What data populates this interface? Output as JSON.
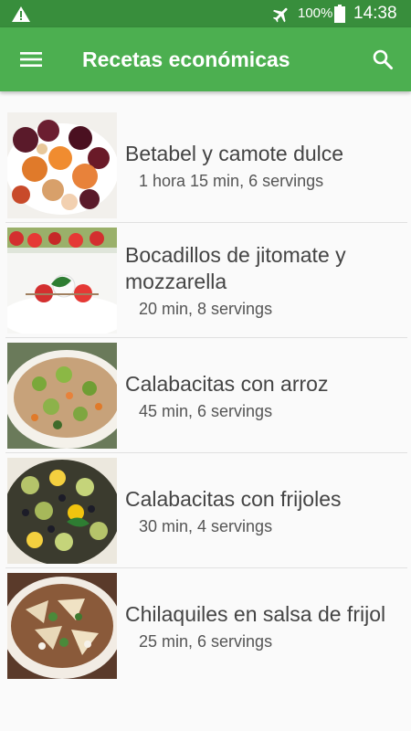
{
  "status_bar": {
    "battery": "100%",
    "time": "14:38",
    "icons": [
      "warning-icon",
      "airplane-mode-icon",
      "battery-icon"
    ]
  },
  "app_bar": {
    "title": "Recetas económicas",
    "icons": [
      "menu-icon",
      "search-icon"
    ]
  },
  "colors": {
    "status_bar": "#388e3c",
    "app_bar": "#4caf50"
  },
  "recipes": [
    {
      "name": "Betabel y camote dulce",
      "meta": "1 hora 15 min, 6 servings"
    },
    {
      "name": "Bocadillos de jitomate y mozzarella",
      "meta": "20 min, 8 servings"
    },
    {
      "name": "Calabacitas con arroz",
      "meta": "45 min, 6 servings"
    },
    {
      "name": "Calabacitas con frijoles",
      "meta": "30 min, 4 servings"
    },
    {
      "name": "Chilaquiles en salsa de frijol",
      "meta": "25 min, 6 servings"
    }
  ]
}
